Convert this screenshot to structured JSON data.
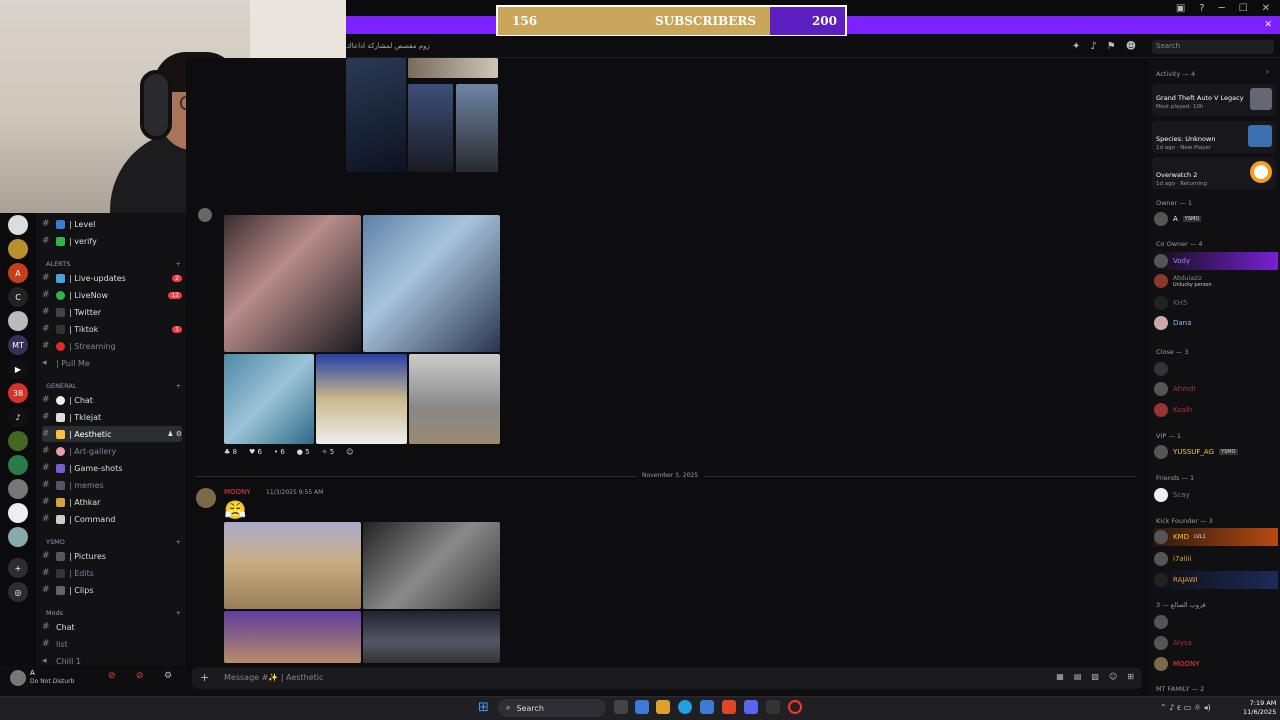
{
  "overlay": {
    "subs_current": "156",
    "subs_label": "SUBSCRIBERS",
    "subs_goal": "200",
    "progress": 0.78
  },
  "channel_topic": "زوم مقصص لمشاركة اداعاك",
  "search": {
    "placeholder": "Search"
  },
  "channels": {
    "top": [
      {
        "label": "| Level"
      },
      {
        "label": "| verify"
      }
    ],
    "alerts_cat": "ALERTS",
    "alerts": [
      {
        "label": "| Live-updates",
        "badge": "2"
      },
      {
        "label": "| LiveNow",
        "badge": "12"
      },
      {
        "label": "| Twitter"
      },
      {
        "label": "| Tiktok",
        "badge": "1"
      },
      {
        "label": "| Streaming"
      },
      {
        "label": "| Pull Me"
      }
    ],
    "general_cat": "GENERAL",
    "general": [
      {
        "label": "| Chat"
      },
      {
        "label": "| Tklejat"
      },
      {
        "label": "| Aesthetic"
      },
      {
        "label": "| Art-gallery"
      },
      {
        "label": "| Game-shots"
      },
      {
        "label": "| memes"
      },
      {
        "label": "| Athkar"
      },
      {
        "label": "| Command"
      }
    ],
    "ysmo_cat": "YSMO",
    "ysmo": [
      {
        "label": "| Pictures"
      },
      {
        "label": "| Edits"
      },
      {
        "label": "| Clips"
      }
    ],
    "mods_cat": "Mods",
    "mods": [
      {
        "label": "Chat"
      },
      {
        "label": "list"
      },
      {
        "label": "Chill 1"
      }
    ]
  },
  "user": {
    "name": "A",
    "status": "Do Not Disturb"
  },
  "reactions": [
    "8",
    "6",
    "6",
    "5",
    "5"
  ],
  "date_divider": "November 3, 2025",
  "message": {
    "author": "MOONY",
    "time": "11/3/2025 9:55 AM"
  },
  "composer": {
    "placeholder": "Message #✨ | Aesthetic"
  },
  "activity": {
    "title": "Activity — 4",
    "items": [
      {
        "game": "Grand Theft Auto V Legacy",
        "meta": "Most played: 10h"
      },
      {
        "game": "Species: Unknown",
        "meta": "1d ago · New Player"
      },
      {
        "game": "Overwatch 2",
        "meta": "1d ago · Returning"
      }
    ]
  },
  "member_groups": [
    {
      "title": "Owner — 1",
      "members": [
        "A"
      ],
      "tag": "YSMO"
    },
    {
      "title": "Co Owner — 4",
      "members": [
        "Vody",
        "Abdulaziz",
        "KH5",
        "Dana"
      ],
      "sub": "Unlucky person"
    },
    {
      "title": "Close — 3",
      "members": [
        "",
        "Ahmdr",
        "Koalh"
      ]
    },
    {
      "title": "VIP — 1",
      "members": [
        "YUSSUF_AG"
      ],
      "tag": "YSMO"
    },
    {
      "title": "Friends — 1",
      "members": [
        "Scay"
      ]
    },
    {
      "title": "Kick Founder — 3",
      "members": [
        "KMD",
        "i7aliii",
        "RAJAWI"
      ],
      "tag": "LVL1"
    },
    {
      "title": "قروب الصالع — 3",
      "members": [
        "",
        "Alysa",
        "MOONY"
      ]
    },
    {
      "title": "MT FAMILY — 2",
      "members": []
    }
  ],
  "taskbar": {
    "search": "Search",
    "time": "7:19 AM",
    "date": "11/6/2025"
  },
  "colors": {
    "accent": "#7b22ff",
    "gold": "#c9a65a",
    "dnd": "#f23f43"
  }
}
